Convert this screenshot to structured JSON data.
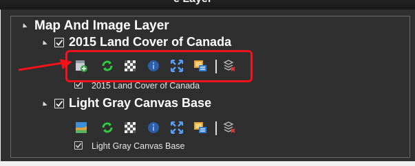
{
  "top_partial_text": "e Layer",
  "tree": {
    "group_label": "Map And Image Layer",
    "layers": [
      {
        "title": "2015 Land Cover of Canada",
        "checked": true,
        "sublayer": "2015 Land Cover of Canada",
        "sublayer_checked": true,
        "first_tool_icon": "layer-add-icon"
      },
      {
        "title": "Light Gray Canvas Base",
        "checked": true,
        "sublayer": "Light Gray Canvas Base",
        "sublayer_checked": true,
        "first_tool_icon": "basemap-icon"
      }
    ]
  },
  "toolbar_icons": [
    "layer-add-icon",
    "refresh-icon",
    "transparency-icon",
    "info-icon",
    "zoom-to-extent-icon",
    "legend-icon",
    "remove-layer-icon"
  ],
  "colors": {
    "panel": "#2f2f2f",
    "highlight": "#f5121a",
    "refresh_green": "#2ecc40",
    "info_blue": "#3a7bd5"
  }
}
